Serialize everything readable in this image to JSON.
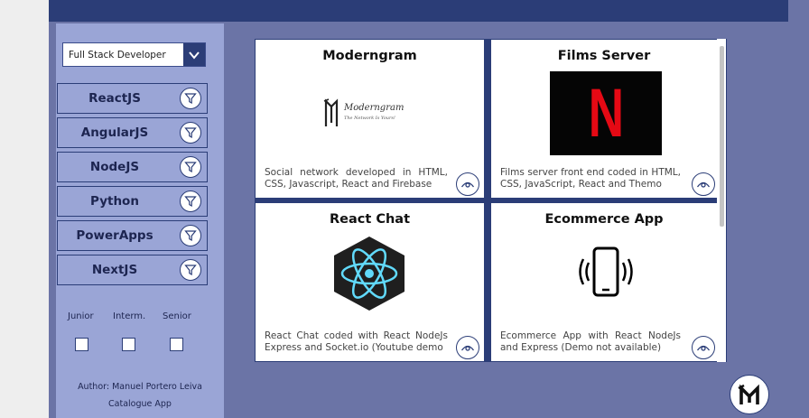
{
  "sidebar": {
    "role_select": {
      "value": "Full Stack Developer"
    },
    "technologies": [
      "ReactJS",
      "AngularJS",
      "NodeJS",
      "Python",
      "PowerApps",
      "NextJS"
    ],
    "levels": [
      "Junior",
      "Interm.",
      "Senior"
    ],
    "author": "Author: Manuel Portero Leiva",
    "app_name": "Catalogue App"
  },
  "cards": [
    {
      "title": "Moderngram",
      "description": "Social network developed in HTML, CSS, Javascript, React and Firebase",
      "logo_text": "Moderngram",
      "logo_tagline": "The Network Is Yours!"
    },
    {
      "title": "Films Server",
      "description": "Films server front end coded in HTML, CSS, JavaScript, React and Themo",
      "logo_text": "N"
    },
    {
      "title": "React Chat",
      "description": "React Chat coded with React NodeJs Express and Socket.io (Youtube demo"
    },
    {
      "title": "Ecommerce App",
      "description": "Ecommerce App with React NodeJs and Express (Demo not available)"
    }
  ],
  "colors": {
    "primary": "#2b3d77",
    "sidebar": "#9aa5d6",
    "background": "#6b74a6",
    "netflix_red": "#e50914"
  }
}
